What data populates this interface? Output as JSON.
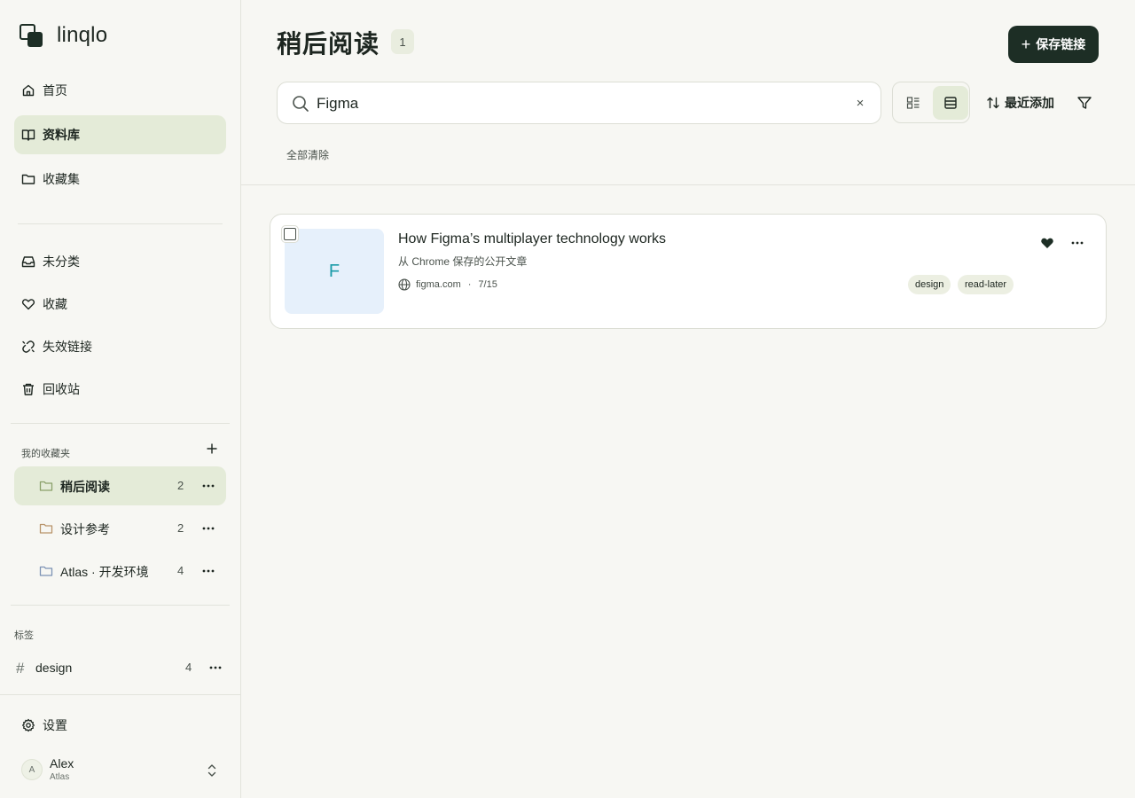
{
  "brand": {
    "name": "linqlo"
  },
  "sidebar": {
    "nav": [
      {
        "label": "首页",
        "icon": "home-icon"
      },
      {
        "label": "资料库",
        "icon": "book-icon",
        "active": true
      },
      {
        "label": "收藏集",
        "icon": "folder-icon"
      }
    ],
    "nav2": [
      {
        "label": "未分类",
        "icon": "inbox-icon"
      },
      {
        "label": "收藏",
        "icon": "heart-icon"
      },
      {
        "label": "失效链接",
        "icon": "broken-link-icon"
      },
      {
        "label": "回收站",
        "icon": "trash-icon"
      }
    ],
    "collections_label": "我的收藏夹",
    "collections": [
      {
        "label": "稍后阅读",
        "count": "2",
        "folder_color": "#8aa06a",
        "active": true
      },
      {
        "label": "设计参考",
        "count": "2",
        "folder_color": "#b8946a"
      },
      {
        "label": "Atlas · 开发环境",
        "count": "4",
        "folder_color": "#7d93b5"
      }
    ],
    "tags_label": "标签",
    "tags": [
      {
        "label": "design",
        "count": "4"
      }
    ],
    "settings_label": "设置",
    "user": {
      "initial": "A",
      "name": "Alex",
      "org": "Atlas"
    }
  },
  "main": {
    "title": "稍后阅读",
    "title_count": "1",
    "save_button": "保存链接",
    "search": {
      "value": "Figma",
      "clear": "×"
    },
    "view_mode": "list",
    "sort_label": "最近添加",
    "clear_all": "全部清除"
  },
  "items": [
    {
      "title": "How Figma’s multiplayer technology works",
      "subtitle": "从 Chrome 保存的公开文章",
      "thumb_letter": "F",
      "domain": "figma.com",
      "date": "7/15",
      "favorited": true,
      "tags": [
        "design",
        "read-later"
      ]
    }
  ],
  "colors": {
    "accent_dark": "#1d2e25",
    "active_bg": "#e4ebd8",
    "background": "#f7f7f3",
    "thumb_bg": "#e6f0fb",
    "thumb_letter": "#1a9ba8"
  }
}
